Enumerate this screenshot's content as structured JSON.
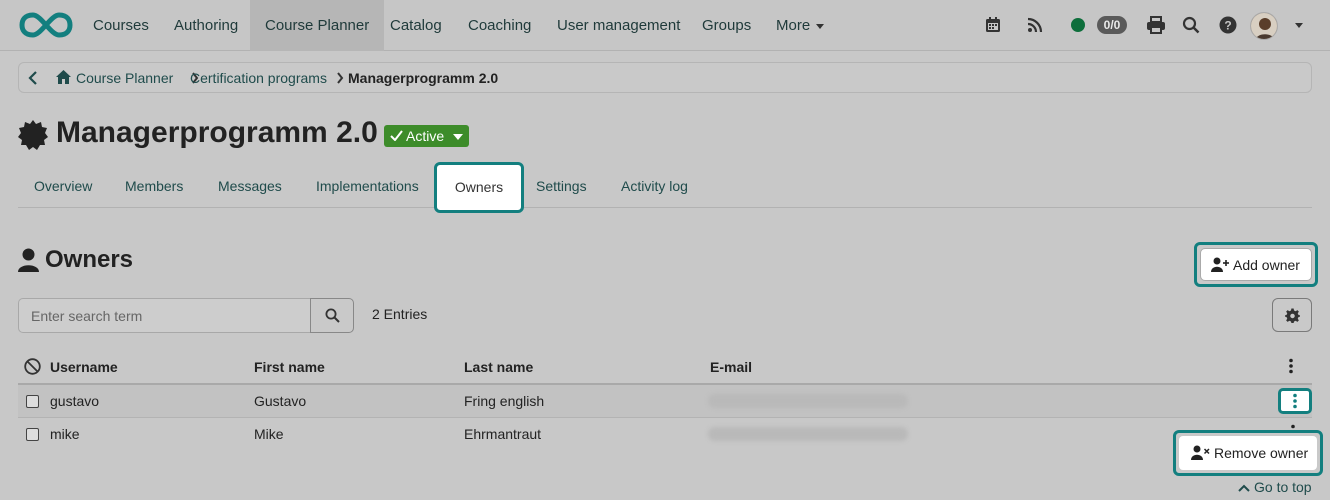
{
  "navbar": {
    "items": [
      "Courses",
      "Authoring",
      "Course Planner",
      "Catalog",
      "Coaching",
      "User management",
      "Groups",
      "More"
    ],
    "active": "Course Planner",
    "badge": "0/0",
    "status_color": "#0d6e3b"
  },
  "breadcrumb": {
    "items": [
      "Course Planner",
      "Certification programs"
    ],
    "current": "Managerprogramm 2.0"
  },
  "page": {
    "title": "Managerprogramm 2.0",
    "status": "Active",
    "status_color": "#3d8c2a"
  },
  "tabs": [
    "Overview",
    "Members",
    "Messages",
    "Implementations",
    "Owners",
    "Settings",
    "Activity log"
  ],
  "active_tab": "Owners",
  "section": {
    "title": "Owners",
    "add_button": "Add owner"
  },
  "search": {
    "placeholder": "Enter search term",
    "entries": "2 Entries"
  },
  "table": {
    "columns": [
      "Username",
      "First name",
      "Last name",
      "E-mail"
    ],
    "rows": [
      {
        "username": "gustavo",
        "first_name": "Gustavo",
        "last_name": "Fring english"
      },
      {
        "username": "mike",
        "first_name": "Mike",
        "last_name": "Ehrmantraut"
      }
    ]
  },
  "row_menu": {
    "remove": "Remove owner"
  },
  "footer": {
    "goto_top": "Go to top"
  },
  "accent_color": "#137f7f"
}
